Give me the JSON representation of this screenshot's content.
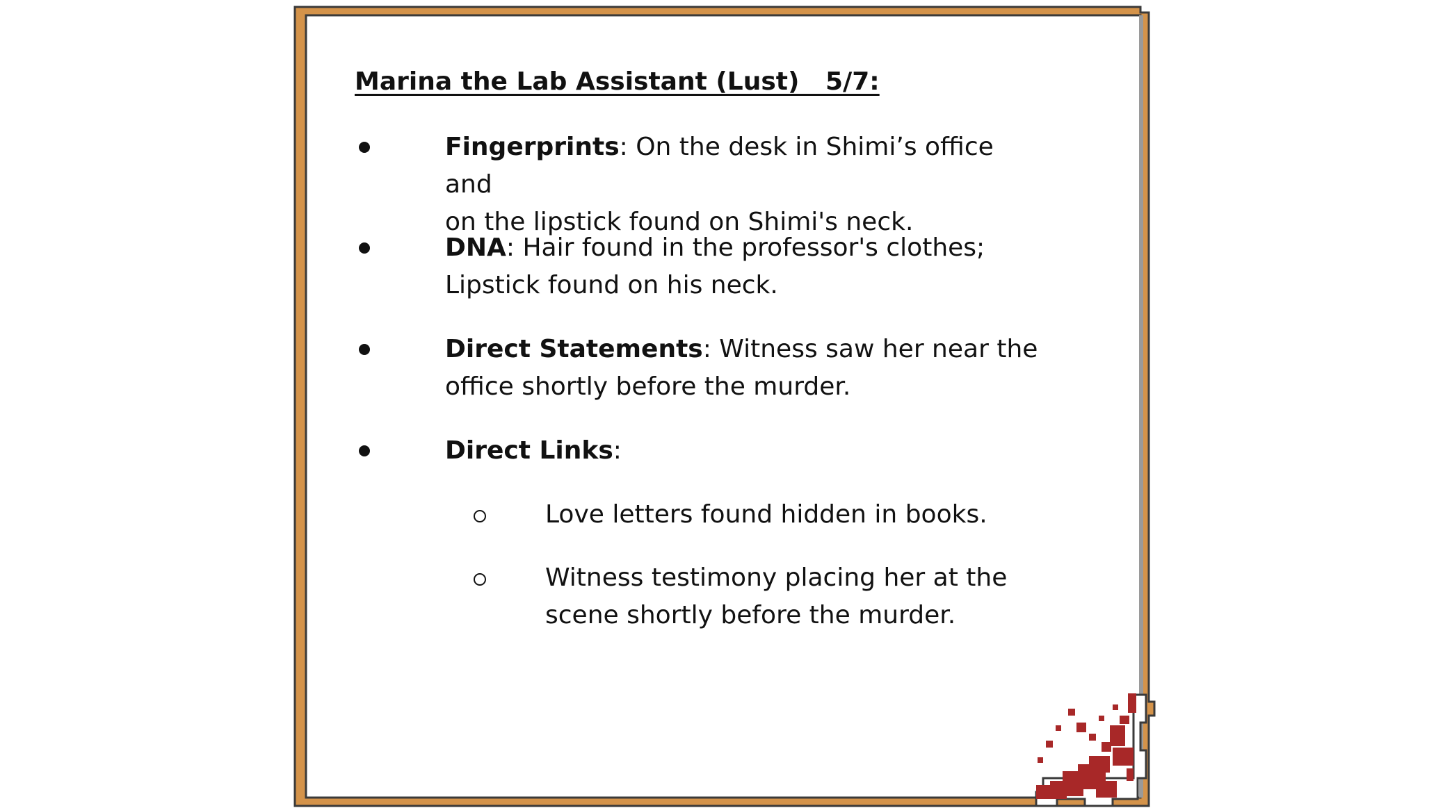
{
  "title": "Marina the Lab Assistant (Lust)   5/7:",
  "items": [
    {
      "label": "Fingerprints",
      "text_line1": ": On the desk in Shimi’s office and",
      "text_line2": "on the lipstick found on Shimi's neck."
    },
    {
      "label": "DNA",
      "text_line1": ": Hair found in the professor's clothes;",
      "text_line2": "Lipstick found on his neck."
    },
    {
      "label": "Direct Statements",
      "text_line1": ": Witness saw her near the",
      "text_line2": "office shortly before the murder."
    },
    {
      "label": "Direct Links",
      "text_line1": ":",
      "text_line2": ""
    }
  ],
  "subitems": [
    {
      "text_line1": "Love letters found hidden in books.",
      "text_line2": ""
    },
    {
      "text_line1": "Witness testimony placing her at the",
      "text_line2": "scene shortly before the murder."
    }
  ],
  "colors": {
    "frame_orange": "#D4934A",
    "frame_outline": "#3a3a3a",
    "blood_red": "#A82828",
    "text": "#111111"
  }
}
